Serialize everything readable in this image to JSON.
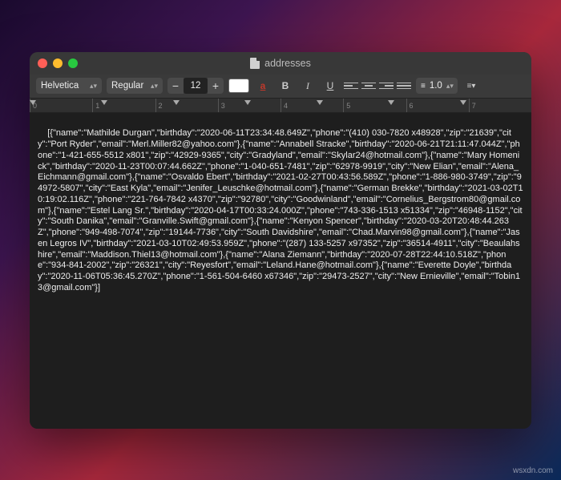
{
  "window": {
    "title": "addresses"
  },
  "toolbar": {
    "font_family": "Helvetica",
    "font_weight": "Regular",
    "font_size": "12",
    "color_hex": "#ffffff",
    "line_spacing": "1.0",
    "character_btn": "a",
    "bold_btn": "B",
    "italic_btn": "I",
    "underline_btn": "U"
  },
  "ruler": {
    "ticks": [
      "0",
      "1",
      "2",
      "3",
      "4",
      "5",
      "6",
      "7"
    ]
  },
  "document": {
    "text": "[{\"name\":\"Mathilde Durgan\",\"birthday\":\"2020-06-11T23:34:48.649Z\",\"phone\":\"(410) 030-7820 x48928\",\"zip\":\"21639\",\"city\":\"Port Ryder\",\"email\":\"Merl.Miller82@yahoo.com\"},{\"name\":\"Annabell Stracke\",\"birthday\":\"2020-06-21T21:11:47.044Z\",\"phone\":\"1-421-655-5512 x801\",\"zip\":\"42929-9365\",\"city\":\"Gradyland\",\"email\":\"Skylar24@hotmail.com\"},{\"name\":\"Mary Homenick\",\"birthday\":\"2020-11-23T00:07:44.662Z\",\"phone\":\"1-040-651-7481\",\"zip\":\"62978-9919\",\"city\":\"New Elian\",\"email\":\"Alena_Eichmann@gmail.com\"},{\"name\":\"Osvaldo Ebert\",\"birthday\":\"2021-02-27T00:43:56.589Z\",\"phone\":\"1-886-980-3749\",\"zip\":\"94972-5807\",\"city\":\"East Kyla\",\"email\":\"Jenifer_Leuschke@hotmail.com\"},{\"name\":\"German Brekke\",\"birthday\":\"2021-03-02T10:19:02.116Z\",\"phone\":\"221-764-7842 x4370\",\"zip\":\"92780\",\"city\":\"Goodwinland\",\"email\":\"Cornelius_Bergstrom80@gmail.com\"},{\"name\":\"Estel Lang Sr.\",\"birthday\":\"2020-04-17T00:33:24.000Z\",\"phone\":\"743-336-1513 x51334\",\"zip\":\"46948-1152\",\"city\":\"South Danika\",\"email\":\"Granville.Swift@gmail.com\"},{\"name\":\"Kenyon Spencer\",\"birthday\":\"2020-03-20T20:48:44.263Z\",\"phone\":\"949-498-7074\",\"zip\":\"19144-7736\",\"city\":\"South Davidshire\",\"email\":\"Chad.Marvin98@gmail.com\"},{\"name\":\"Jasen Legros IV\",\"birthday\":\"2021-03-10T02:49:53.959Z\",\"phone\":\"(287) 133-5257 x97352\",\"zip\":\"36514-4911\",\"city\":\"Beaulahshire\",\"email\":\"Maddison.Thiel13@hotmail.com\"},{\"name\":\"Alana Ziemann\",\"birthday\":\"2020-07-28T22:44:10.518Z\",\"phone\":\"934-841-2002\",\"zip\":\"26321\",\"city\":\"Reyesfort\",\"email\":\"Leland.Hane@hotmail.com\"},{\"name\":\"Everette Doyle\",\"birthday\":\"2020-11-06T05:36:45.270Z\",\"phone\":\"1-561-504-6460 x67346\",\"zip\":\"29473-2527\",\"city\":\"New Ernieville\",\"email\":\"Tobin13@gmail.com\"}]"
  },
  "watermark": "wsxdn.com"
}
